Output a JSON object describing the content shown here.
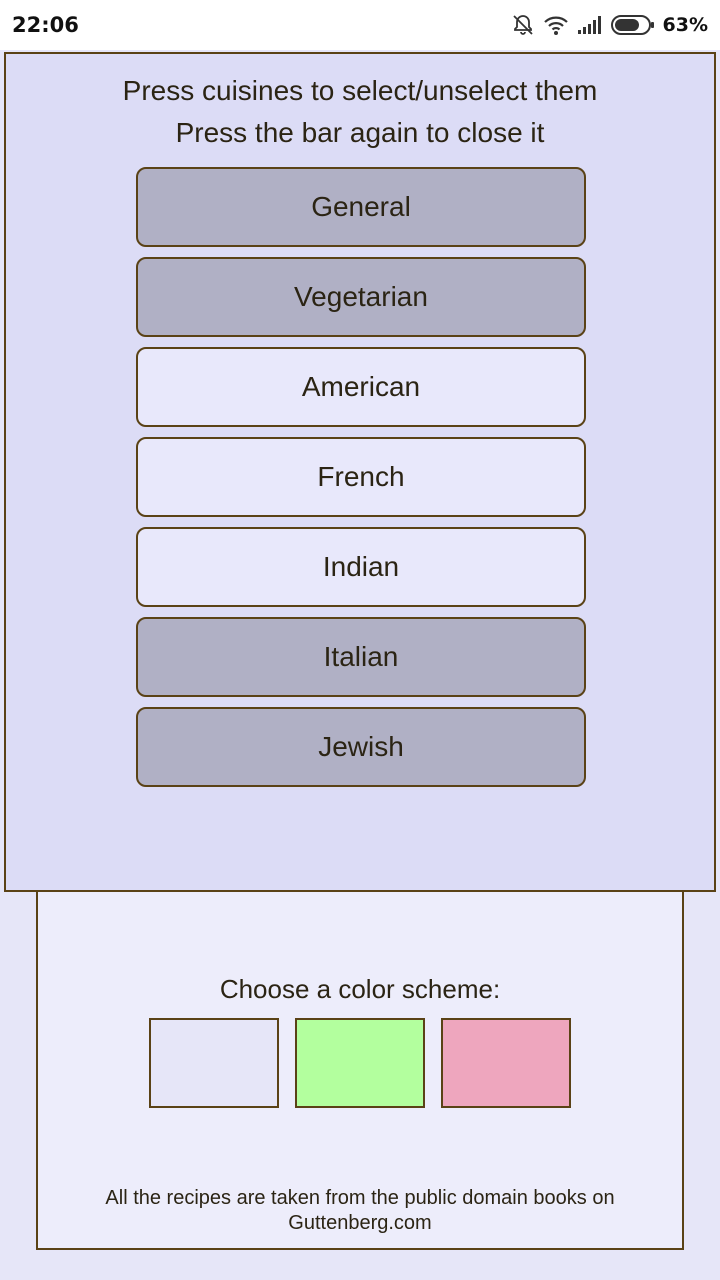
{
  "status_bar": {
    "time": "22:06",
    "battery_percent": "63%",
    "icons": [
      "notifications-off-icon",
      "wifi-icon",
      "signal-icon",
      "battery-icon"
    ]
  },
  "cuisine_panel": {
    "instruction_line1": "Press cuisines to select/unselect them",
    "instruction_line2": "Press the bar again to close it",
    "cuisines": [
      {
        "label": "General",
        "selected": true
      },
      {
        "label": "Vegetarian",
        "selected": true
      },
      {
        "label": "American",
        "selected": false
      },
      {
        "label": "French",
        "selected": false
      },
      {
        "label": "Indian",
        "selected": false
      },
      {
        "label": "Italian",
        "selected": true
      },
      {
        "label": "Jewish",
        "selected": true
      }
    ]
  },
  "settings": {
    "color_scheme_label": "Choose a color scheme:",
    "color_schemes": [
      {
        "name": "lavender",
        "color": "#e6e6f8"
      },
      {
        "name": "green",
        "color": "#b3ff9e"
      },
      {
        "name": "pink",
        "color": "#eea6be"
      }
    ],
    "footer_line1": "All the recipes are taken from the public domain books on",
    "footer_line2": "Guttenberg.com"
  },
  "colors": {
    "border": "#5a4216",
    "selected_bg": "#b0b0c5",
    "unselected_bg": "#e8e8fb",
    "panel_bg": "#dcdcf6"
  }
}
